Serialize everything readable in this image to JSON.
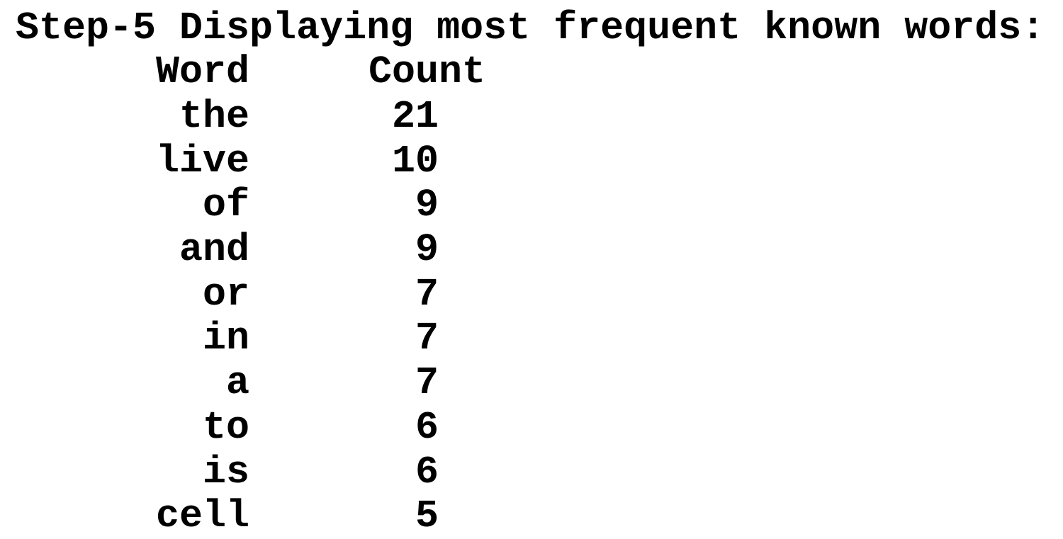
{
  "output": {
    "heading": "Step-5 Displaying most frequent known words:",
    "table": {
      "columns": [
        "Word",
        "Count"
      ],
      "rows": [
        {
          "word": "the",
          "count": "21"
        },
        {
          "word": "live",
          "count": "10"
        },
        {
          "word": "of",
          "count": "9"
        },
        {
          "word": "and",
          "count": "9"
        },
        {
          "word": "or",
          "count": "7"
        },
        {
          "word": "in",
          "count": "7"
        },
        {
          "word": "a",
          "count": "7"
        },
        {
          "word": "to",
          "count": "6"
        },
        {
          "word": "is",
          "count": "6"
        },
        {
          "word": "cell",
          "count": "5"
        }
      ]
    }
  },
  "colors": {
    "background": "#ffffff",
    "text": "#000000"
  }
}
